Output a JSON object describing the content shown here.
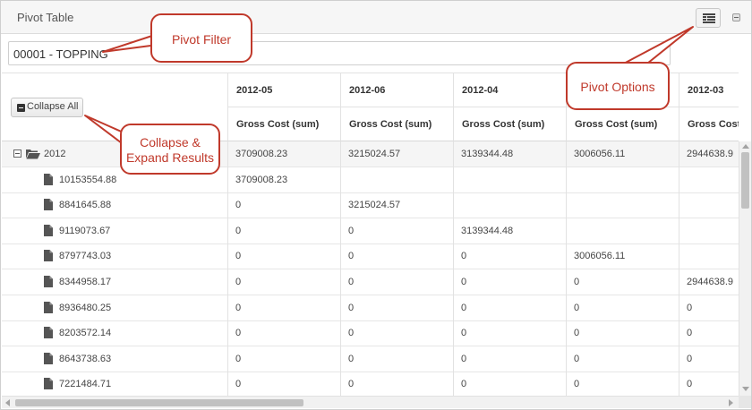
{
  "panel": {
    "title": "Pivot Table",
    "options_icon": "pivot-options-icon",
    "minimize_icon": "minimize-icon"
  },
  "filter": {
    "value": "00001 - TOPPING"
  },
  "controls": {
    "collapse_all_label": "Collapse All",
    "collapse_icon": "minus-square-icon"
  },
  "columns": [
    {
      "date": "2012-05",
      "measure": "Gross Cost (sum)"
    },
    {
      "date": "2012-06",
      "measure": "Gross Cost (sum)"
    },
    {
      "date": "2012-04",
      "measure": "Gross Cost (sum)"
    },
    {
      "date": "",
      "measure": "Gross Cost (sum)"
    },
    {
      "date": "2012-03",
      "measure": "Gross Cost ("
    }
  ],
  "rows": [
    {
      "type": "group",
      "label": "2012",
      "cells": [
        "3709008.23",
        "3215024.57",
        "3139344.48",
        "3006056.11",
        "2944638.9"
      ]
    },
    {
      "type": "item",
      "label": "10153554.88",
      "cells": [
        "3709008.23",
        "",
        "",
        "",
        ""
      ]
    },
    {
      "type": "item",
      "label": "8841645.88",
      "cells": [
        "0",
        "3215024.57",
        "",
        "",
        ""
      ]
    },
    {
      "type": "item",
      "label": "9119073.67",
      "cells": [
        "0",
        "0",
        "3139344.48",
        "",
        ""
      ]
    },
    {
      "type": "item",
      "label": "8797743.03",
      "cells": [
        "0",
        "0",
        "0",
        "3006056.11",
        ""
      ]
    },
    {
      "type": "item",
      "label": "8344958.17",
      "cells": [
        "0",
        "0",
        "0",
        "0",
        "2944638.9"
      ]
    },
    {
      "type": "item",
      "label": "8936480.25",
      "cells": [
        "0",
        "0",
        "0",
        "0",
        "0"
      ]
    },
    {
      "type": "item",
      "label": "8203572.14",
      "cells": [
        "0",
        "0",
        "0",
        "0",
        "0"
      ]
    },
    {
      "type": "item",
      "label": "8643738.63",
      "cells": [
        "0",
        "0",
        "0",
        "0",
        "0"
      ]
    },
    {
      "type": "item",
      "label": "7221484.71",
      "cells": [
        "0",
        "0",
        "0",
        "0",
        "0"
      ]
    }
  ],
  "callouts": {
    "pivot_filter": "Pivot Filter",
    "pivot_options": "Pivot Options",
    "collapse_line1": "Collapse &",
    "collapse_line2": "Expand Results"
  },
  "colors": {
    "callout_red": "#c0392b",
    "header_bg": "#f6f6f6",
    "summary_row_bg": "#f5f5f5"
  }
}
